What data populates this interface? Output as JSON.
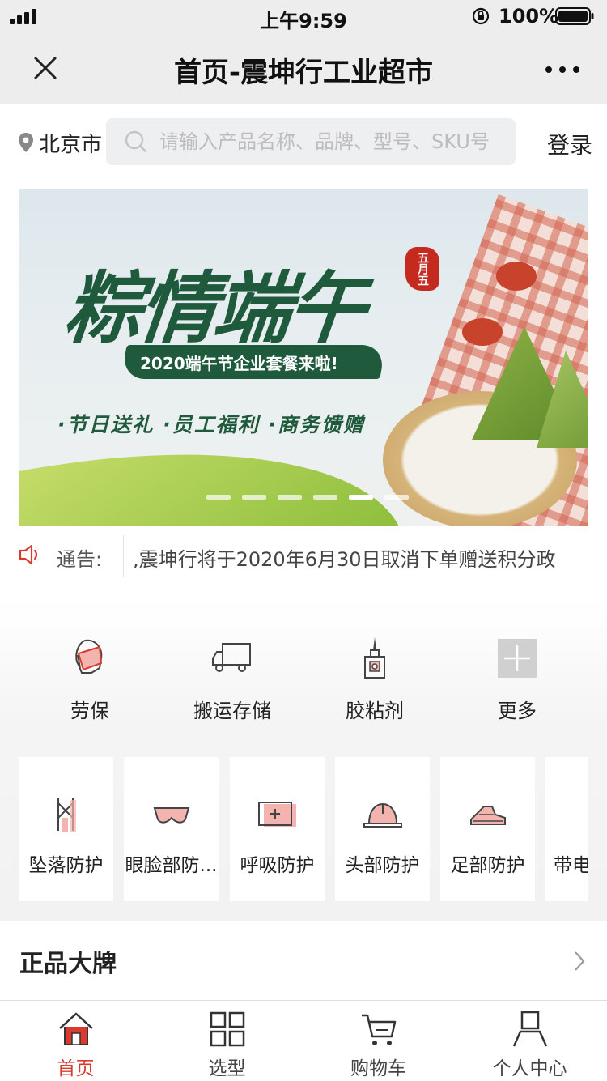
{
  "status_bar": {
    "time": "上午9:59",
    "battery": "100%"
  },
  "nav": {
    "title": "首页-震坤行工业超市",
    "close_icon": "close-icon",
    "more_icon": "more-dots-icon"
  },
  "header": {
    "location": "北京市",
    "search_placeholder": "请输入产品名称、品牌、型号、SKU号",
    "login": "登录"
  },
  "banner": {
    "title": "粽情端午",
    "seal": "五月五",
    "subtitle": "2020端午节企业套餐来啦!",
    "tagline": "·节日送礼 ·员工福利 ·商务馈赠",
    "slide_count": 6,
    "active_slide": 5
  },
  "notice": {
    "label": "通告:",
    "text": ",震坤行将于2020年6月30日取消下单赠送积分政"
  },
  "categories": [
    {
      "label": "劳保",
      "icon": "mask-icon"
    },
    {
      "label": "搬运存储",
      "icon": "truck-icon"
    },
    {
      "label": "胶粘剂",
      "icon": "glue-bottle-icon"
    },
    {
      "label": "更多",
      "icon": "plus-icon"
    }
  ],
  "protection_cards": [
    {
      "label": "坠落防护",
      "icon": "harness-icon"
    },
    {
      "label": "眼脸部防...",
      "icon": "goggles-icon"
    },
    {
      "label": "呼吸防护",
      "icon": "respirator-box-icon"
    },
    {
      "label": "头部防护",
      "icon": "hard-hat-icon"
    },
    {
      "label": "足部防护",
      "icon": "safety-shoe-icon"
    },
    {
      "label": "带电",
      "icon": "glove-icon"
    }
  ],
  "section": {
    "title": "正品大牌"
  },
  "tabbar": [
    {
      "label": "首页",
      "icon": "home-icon",
      "active": true
    },
    {
      "label": "选型",
      "icon": "grid-icon",
      "active": false
    },
    {
      "label": "购物车",
      "icon": "cart-icon",
      "active": false
    },
    {
      "label": "个人中心",
      "icon": "user-icon",
      "active": false
    }
  ],
  "colors": {
    "accent": "#d83a2f",
    "nav_bg": "#ededed",
    "search_bg": "#eeeff1",
    "banner_green": "#1f5a3c"
  }
}
